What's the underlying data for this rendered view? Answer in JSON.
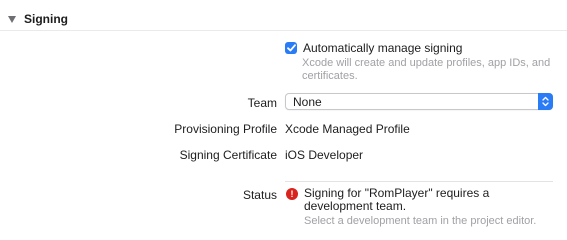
{
  "section": {
    "title": "Signing"
  },
  "auto_signing": {
    "label": "Automatically manage signing",
    "checked": true,
    "hint": "Xcode will create and update profiles, app IDs, and certificates."
  },
  "team": {
    "label": "Team",
    "value": "None"
  },
  "provisioning_profile": {
    "label": "Provisioning Profile",
    "value": "Xcode Managed Profile"
  },
  "signing_certificate": {
    "label": "Signing Certificate",
    "value": "iOS Developer"
  },
  "status": {
    "label": "Status",
    "message": "Signing for \"RomPlayer\" requires a development team.",
    "hint": "Select a development team in the project editor.",
    "icon": "error-icon"
  },
  "colors": {
    "accent": "#2a7bf6",
    "error": "#d8241c",
    "secondary_text": "#a1a1a6"
  }
}
